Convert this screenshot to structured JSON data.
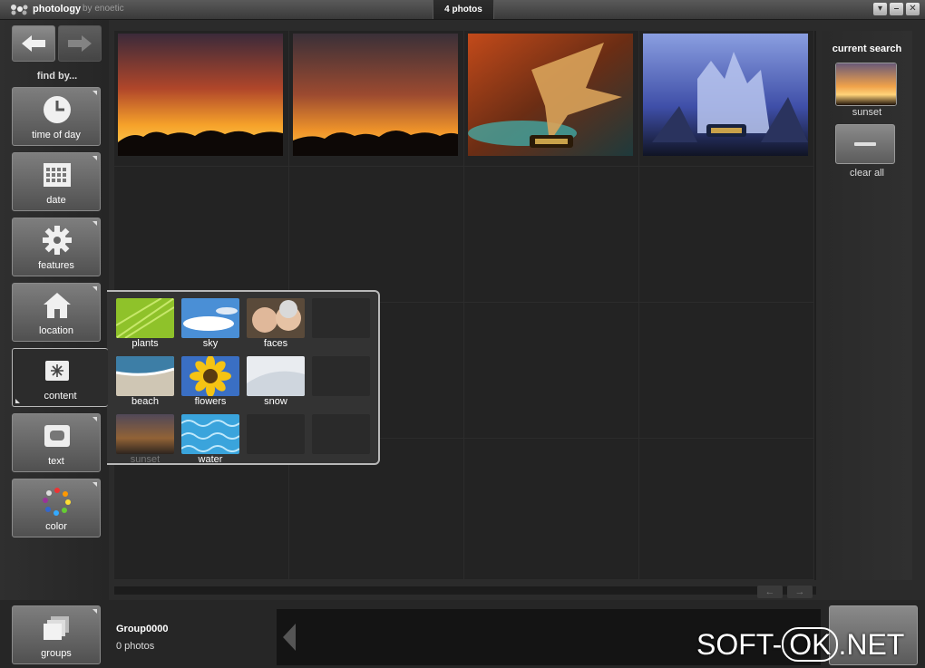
{
  "titlebar": {
    "app_name": "photology",
    "vendor": "by enoetic",
    "photo_count": "4 photos",
    "buttons": [
      "minimize",
      "restore",
      "close"
    ]
  },
  "sidebar": {
    "find_by_label": "find by...",
    "filters": [
      {
        "label": "time of day",
        "icon": "clock-icon"
      },
      {
        "label": "date",
        "icon": "calendar-icon"
      },
      {
        "label": "features",
        "icon": "gear-icon"
      },
      {
        "label": "location",
        "icon": "house-icon"
      },
      {
        "label": "content",
        "icon": "sparkle-icon",
        "active": true
      },
      {
        "label": "text",
        "icon": "speech-bubble-icon"
      },
      {
        "label": "color",
        "icon": "color-wheel-icon"
      }
    ],
    "groups_label": "groups"
  },
  "content_popup": {
    "tiles": [
      {
        "label": "plants"
      },
      {
        "label": "sky"
      },
      {
        "label": "faces"
      },
      {
        "label": ""
      },
      {
        "label": "beach"
      },
      {
        "label": "flowers"
      },
      {
        "label": "snow"
      },
      {
        "label": ""
      },
      {
        "label": "sunset",
        "dimmed": true
      },
      {
        "label": "water"
      },
      {
        "label": ""
      },
      {
        "label": ""
      }
    ]
  },
  "grid": {
    "photos": [
      "sunset-photo-1",
      "sunset-photo-2",
      "warcraft-wallpaper-1",
      "warcraft-wallpaper-2"
    ]
  },
  "current_search": {
    "title": "current search",
    "item_label": "sunset",
    "clear_label": "clear all"
  },
  "group": {
    "name": "Group0000",
    "count": "0 photos"
  },
  "watermark": {
    "prefix": "SOFT-",
    "ring": "OK",
    "suffix": ".NET"
  }
}
